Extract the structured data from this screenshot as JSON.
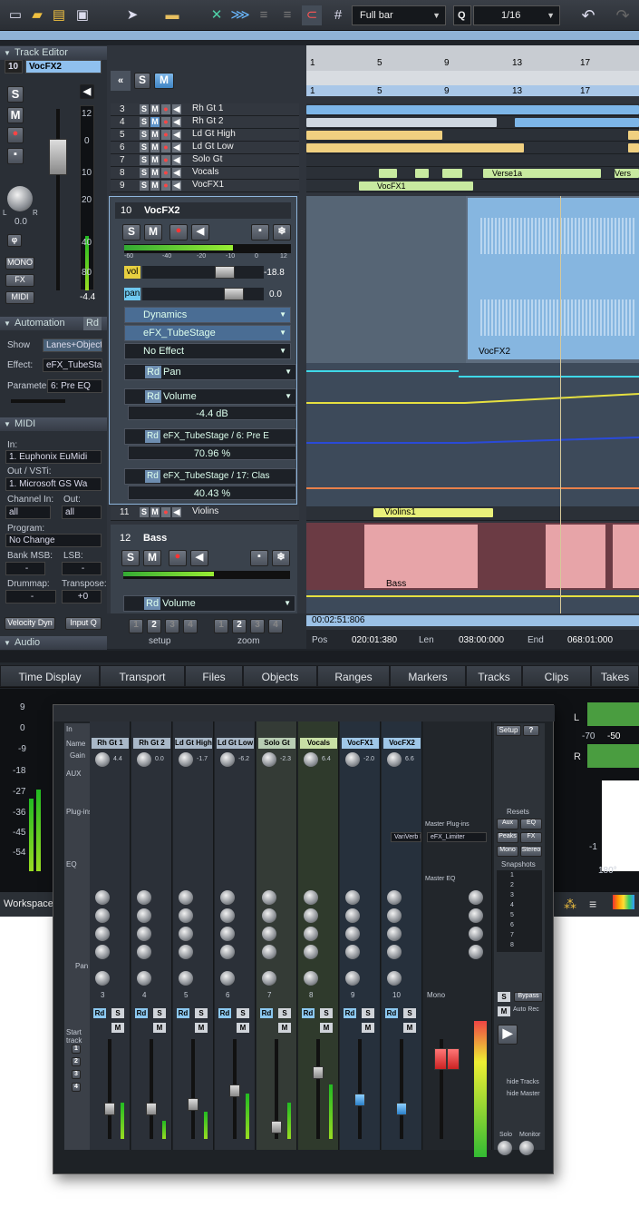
{
  "toolbar": {
    "bar_mode": "Full bar",
    "quantize_label": "Q",
    "quantize": "1/16"
  },
  "ruler": {
    "top": [
      "1",
      "5",
      "9",
      "13",
      "17"
    ],
    "bottom": [
      "1",
      "5",
      "9",
      "13",
      "17"
    ]
  },
  "track_editor": {
    "header": "Track Editor",
    "track_no": "10",
    "track_name": "VocFX2",
    "s": "S",
    "m": "M",
    "pan": "0.0",
    "fx": "FX",
    "mono": "MONO",
    "midi": "MIDI",
    "db": "-4.4",
    "scale": [
      "12",
      "0",
      "10",
      "20",
      "40",
      "80"
    ],
    "l": "L",
    "r": "R"
  },
  "automation": {
    "header": "Automation",
    "rd": "Rd",
    "show_label": "Show",
    "show_value": "Lanes+Object",
    "effect_label": "Effect:",
    "effect_value": "eFX_TubeSta",
    "param_label": "Parameter",
    "param_value": "6: Pre EQ"
  },
  "midi": {
    "header": "MIDI",
    "in_label": "In:",
    "in_value": "1. Euphonix EuMidi",
    "out_label": "Out / VSTi:",
    "out_value": "1. Microsoft GS Wa",
    "ch_in_label": "Channel In:",
    "ch_in": "all",
    "out2_label": "Out:",
    "out2": "all",
    "program_label": "Program:",
    "program": "No Change",
    "bank_label": "Bank MSB:",
    "lsb_label": "LSB:",
    "bank": "-",
    "lsb": "-",
    "drummap_label": "Drummap:",
    "transpose_label": "Transpose:",
    "drummap": "-",
    "transpose": "+0",
    "velocity": "Velocity Dyn",
    "input_q": "Input Q"
  },
  "audio_header": "Audio",
  "tracks": [
    {
      "n": "3",
      "name": "Rh Gt 1"
    },
    {
      "n": "4",
      "name": "Rh Gt 2"
    },
    {
      "n": "5",
      "name": "Ld Gt High"
    },
    {
      "n": "6",
      "name": "Ld Gt Low"
    },
    {
      "n": "7",
      "name": "Solo Gt"
    },
    {
      "n": "8",
      "name": "Vocals"
    },
    {
      "n": "9",
      "name": "VocFX1"
    }
  ],
  "clips": {
    "vocfx1": "VocFX1",
    "verse1a": "Verse1a",
    "vers": "Vers",
    "vocfx2": "VocFX2",
    "violins": "Violins1",
    "bass": "Bass"
  },
  "vocfx2": {
    "n": "10",
    "name": "VocFX2",
    "s": "S",
    "m": "M",
    "vol_label": "vol",
    "vol": "-18.8",
    "pan_label": "pan",
    "pan": "0.0",
    "fx1": "Dynamics",
    "fx2": "eFX_TubeStage",
    "fx3": "No Effect",
    "scale": [
      "-60",
      "-40",
      "-20",
      "-10",
      "0",
      "12"
    ],
    "lanes": [
      {
        "rd": "Rd",
        "name": "Pan",
        "value": ""
      },
      {
        "rd": "Rd",
        "name": "Volume",
        "value": "-4.4 dB"
      },
      {
        "rd": "Rd",
        "name": "eFX_TubeStage / 6: Pre E",
        "value": "70.96 %"
      },
      {
        "rd": "Rd",
        "name": "eFX_TubeStage / 17: Clas",
        "value": "40.43 %"
      }
    ]
  },
  "violins": {
    "n": "11",
    "name": "Violins"
  },
  "bass": {
    "n": "12",
    "name": "Bass",
    "s": "S",
    "m": "M",
    "lane_rd": "Rd",
    "lane": "Volume"
  },
  "nav": {
    "setup": [
      "1",
      "2",
      "3",
      "4"
    ],
    "setup_label": "setup",
    "zoom": [
      "1",
      "2",
      "3",
      "4"
    ],
    "zoom_label": "zoom",
    "time": "00:02:51:806"
  },
  "pos": {
    "pos_label": "Pos",
    "pos": "020:01:380",
    "len_label": "Len",
    "len": "038:00:000",
    "end_label": "End",
    "end": "068:01:000"
  },
  "tabs": [
    "Time Display",
    "Transport",
    "Files",
    "Objects",
    "Ranges",
    "Markers",
    "Tracks",
    "Clips",
    "Takes"
  ],
  "meters": {
    "left_scale": [
      "9",
      "0",
      "-9",
      "-18",
      "-27",
      "-36",
      "-45",
      "-54"
    ],
    "l": "L",
    "r": "R",
    "v1": "-70",
    "v2": "-50",
    "neg1": "-1",
    "deg": "180°",
    "workspace": "Workspace"
  },
  "mixer": {
    "in": "In",
    "name_label": "Name",
    "gain_label": "Gain",
    "aux": "AUX",
    "plugins": "Plug-ins",
    "eq": "EQ",
    "pan": "Pan",
    "start_track": "Start track",
    "setup": "Setup",
    "q": "?",
    "resets": "Resets",
    "aux_btn": "Aux",
    "eq_btn": "EQ",
    "peaks": "Peaks",
    "fx": "FX",
    "mono": "Mono",
    "stereo": "Stereo",
    "snapshots": "Snapshots",
    "snap": [
      "1",
      "2",
      "3",
      "4",
      "5",
      "6",
      "7",
      "8"
    ],
    "master_plugins": "Master Plug-ins",
    "master_eq": "Master EQ",
    "master_pl1": "eFX_Limiter",
    "master_pl2": "VariVerb Pr",
    "bypass": "Bypass",
    "auto_rec": "Auto Rec",
    "hide_tracks": "hide Tracks",
    "hide_master": "hide Master",
    "solo": "Solo",
    "monitor": "Monitor",
    "master_mono": "Mono",
    "stereo_lbl": "Stereo",
    "strips": [
      {
        "n": "3",
        "name": "Rh Gt 1",
        "gain": "4.4",
        "color": "#a9b8c8"
      },
      {
        "n": "4",
        "name": "Rh Gt 2",
        "gain": "0.0",
        "color": "#a9b8c8"
      },
      {
        "n": "5",
        "name": "Ld Gt High",
        "gain": "-1.7",
        "color": "#a9b8c8"
      },
      {
        "n": "6",
        "name": "Ld Gt Low",
        "gain": "-6.2",
        "color": "#a9b8c8"
      },
      {
        "n": "7",
        "name": "Solo Gt",
        "gain": "-2.3",
        "color": "#b8cdb3"
      },
      {
        "n": "8",
        "name": "Vocals",
        "gain": "6.4",
        "color": "#c8dfa5"
      },
      {
        "n": "9",
        "name": "VocFX1",
        "gain": "-2.0",
        "color": "#9fc7e8"
      },
      {
        "n": "10",
        "name": "VocFX2",
        "gain": "6.6",
        "color": "#9fc7e8"
      }
    ]
  }
}
